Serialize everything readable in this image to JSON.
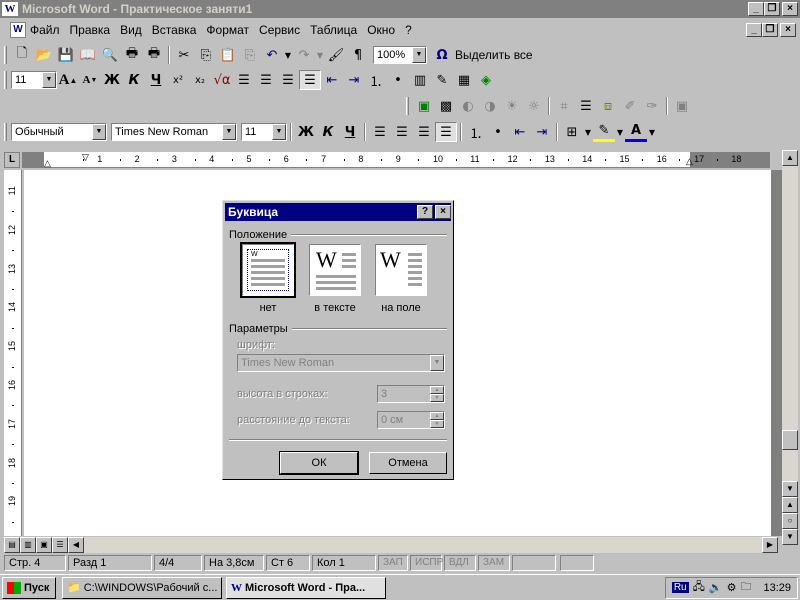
{
  "window": {
    "title": "Microsoft Word - Практическое заняти1"
  },
  "menu": [
    "Файл",
    "Правка",
    "Вид",
    "Вставка",
    "Формат",
    "Сервис",
    "Таблица",
    "Окно",
    "?"
  ],
  "toolbar": {
    "zoom": "100%",
    "select_all": "Выделить все",
    "font_size_small": "11"
  },
  "format_bar": {
    "style": "Обычный",
    "font": "Times New Roman",
    "size": "11",
    "bold": "Ж",
    "italic": "К",
    "underline": "Ч"
  },
  "format_bar2": {
    "bold": "Ж",
    "italic": "К",
    "underline": "Ч"
  },
  "ruler": {
    "h_ticks": [
      "1",
      "2",
      "3",
      "4",
      "5",
      "6",
      "7",
      "8",
      "9",
      "10",
      "11",
      "12",
      "13",
      "14",
      "15",
      "16",
      "17",
      "18"
    ],
    "v_ticks": [
      "11",
      "12",
      "13",
      "14",
      "15",
      "16",
      "17",
      "18",
      "19"
    ]
  },
  "dialog": {
    "title": "Буквица",
    "position_label": "Положение",
    "options": [
      {
        "label": "нет"
      },
      {
        "label": "в тексте"
      },
      {
        "label": "на поле"
      }
    ],
    "params_label": "Параметры",
    "font_label": "шрифт:",
    "font_value": "Times New Roman",
    "height_label": "высота в строках:",
    "height_value": "3",
    "distance_label": "расстояние до текста:",
    "distance_value": "0 см",
    "ok": "ОК",
    "cancel": "Отмена",
    "help": "?",
    "close": "×"
  },
  "status": {
    "page": "Стр. 4",
    "section": "Разд 1",
    "pages": "4/4",
    "at": "На 3,8см",
    "line": "Ст 6",
    "col": "Кол 1",
    "rec": "ЗАП",
    "trk": "ИСПР",
    "ext": "ВДЛ",
    "ovr": "ЗАМ"
  },
  "taskbar": {
    "start": "Пуск",
    "task1": "C:\\WINDOWS\\Рабочий с...",
    "task2": "Microsoft Word - Пра...",
    "lang": "Ru",
    "time": "13:29"
  },
  "colors": {
    "title_active": "#000080",
    "title_inactive": "#808080",
    "face": "#c0c0c0"
  }
}
